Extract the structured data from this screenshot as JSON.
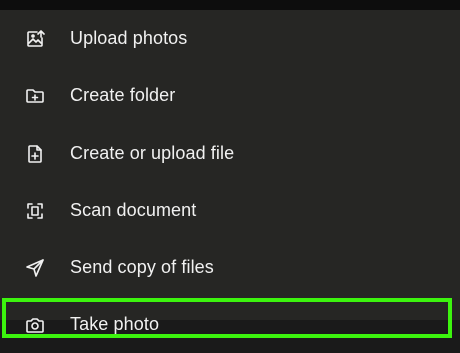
{
  "menu": {
    "items": [
      {
        "label": "Upload photos",
        "icon": "upload-photos-icon"
      },
      {
        "label": "Create folder",
        "icon": "create-folder-icon"
      },
      {
        "label": "Create or upload file",
        "icon": "create-file-icon"
      },
      {
        "label": "Scan document",
        "icon": "scan-document-icon"
      },
      {
        "label": "Send copy of files",
        "icon": "send-icon"
      },
      {
        "label": "Take photo",
        "icon": "camera-icon"
      }
    ]
  },
  "colors": {
    "background": "#262624",
    "text": "#f1f1f1",
    "highlight": "#3cf40e"
  }
}
